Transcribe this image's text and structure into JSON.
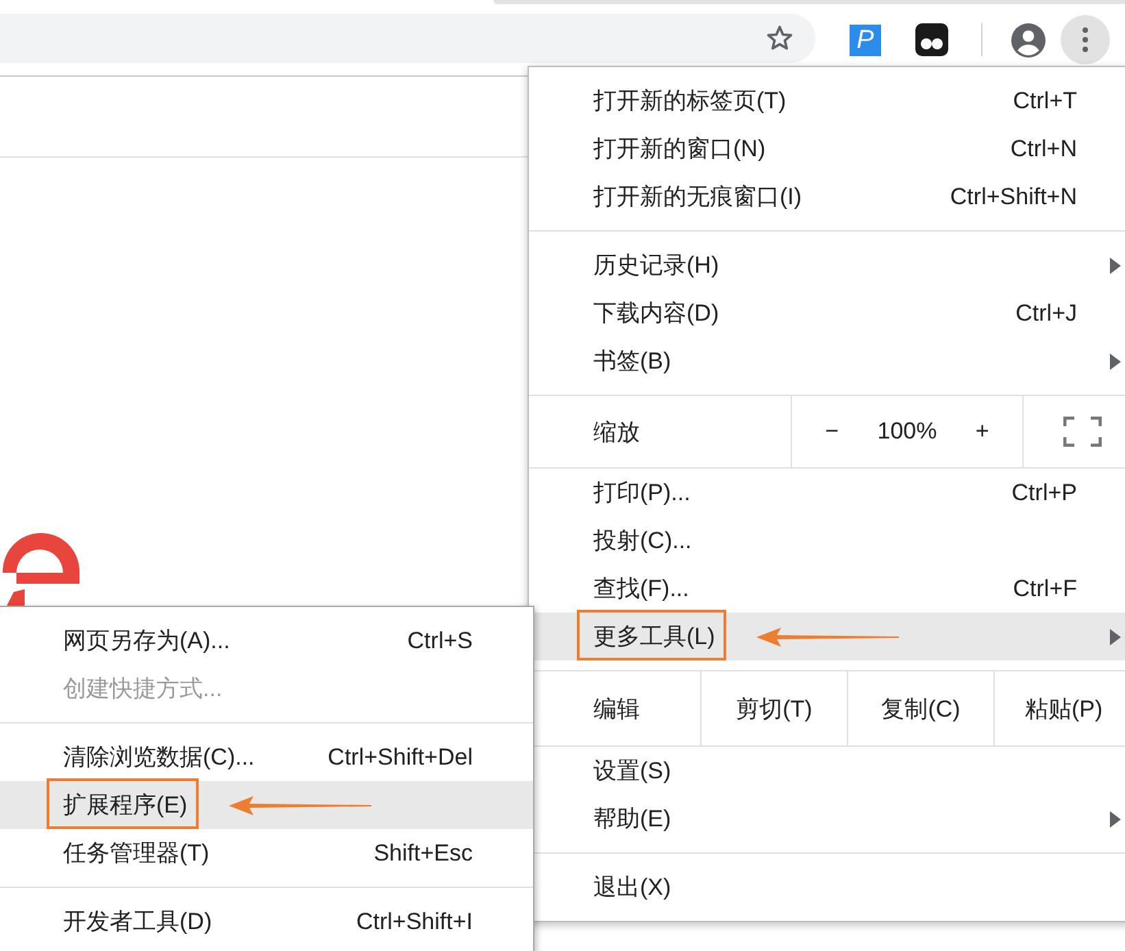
{
  "toolbar": {
    "extensions": [
      {
        "kind": "letter",
        "label": "P"
      },
      {
        "kind": "eyes"
      }
    ]
  },
  "main_menu": {
    "items": [
      {
        "kind": "item",
        "label": "打开新的标签页(T)",
        "shortcut": "Ctrl+T",
        "has_submenu": false,
        "highlighted": false,
        "annotated": false
      },
      {
        "kind": "item",
        "label": "打开新的窗口(N)",
        "shortcut": "Ctrl+N",
        "has_submenu": false,
        "highlighted": false,
        "annotated": false
      },
      {
        "kind": "item",
        "label": "打开新的无痕窗口(I)",
        "shortcut": "Ctrl+Shift+N",
        "has_submenu": false,
        "highlighted": false,
        "annotated": false
      },
      {
        "kind": "separator"
      },
      {
        "kind": "item",
        "label": "历史记录(H)",
        "has_submenu": true,
        "highlighted": false,
        "annotated": false
      },
      {
        "kind": "item",
        "label": "下载内容(D)",
        "shortcut": "Ctrl+J",
        "has_submenu": false,
        "highlighted": false,
        "annotated": false
      },
      {
        "kind": "item",
        "label": "书签(B)",
        "has_submenu": true,
        "highlighted": false,
        "annotated": false
      },
      {
        "kind": "separator"
      },
      {
        "kind": "zoom",
        "label": "缩放",
        "minus": "−",
        "value": "100%",
        "plus": "+"
      },
      {
        "kind": "separator"
      },
      {
        "kind": "item",
        "label": "打印(P)...",
        "shortcut": "Ctrl+P",
        "has_submenu": false,
        "highlighted": false,
        "annotated": false
      },
      {
        "kind": "item",
        "label": "投射(C)...",
        "has_submenu": false,
        "highlighted": false,
        "annotated": false
      },
      {
        "kind": "item",
        "label": "查找(F)...",
        "shortcut": "Ctrl+F",
        "has_submenu": false,
        "highlighted": false,
        "annotated": false
      },
      {
        "kind": "item",
        "label": "更多工具(L)",
        "has_submenu": true,
        "highlighted": true,
        "annotated": true
      },
      {
        "kind": "separator"
      },
      {
        "kind": "edit",
        "label": "编辑",
        "buttons": [
          "剪切(T)",
          "复制(C)",
          "粘贴(P)"
        ]
      },
      {
        "kind": "separator"
      },
      {
        "kind": "item",
        "label": "设置(S)",
        "has_submenu": false,
        "highlighted": false,
        "annotated": false
      },
      {
        "kind": "item",
        "label": "帮助(E)",
        "has_submenu": true,
        "highlighted": false,
        "annotated": false
      },
      {
        "kind": "separator"
      },
      {
        "kind": "item",
        "label": "退出(X)",
        "has_submenu": false,
        "highlighted": false,
        "annotated": false
      }
    ]
  },
  "submenu": {
    "items": [
      {
        "kind": "item",
        "label": "网页另存为(A)...",
        "shortcut": "Ctrl+S",
        "disabled": false,
        "highlighted": false,
        "annotated": false
      },
      {
        "kind": "item",
        "label": "创建快捷方式...",
        "disabled": true,
        "highlighted": false,
        "annotated": false
      },
      {
        "kind": "separator"
      },
      {
        "kind": "item",
        "label": "清除浏览数据(C)...",
        "shortcut": "Ctrl+Shift+Del",
        "disabled": false,
        "highlighted": false,
        "annotated": false
      },
      {
        "kind": "item",
        "label": "扩展程序(E)",
        "disabled": false,
        "highlighted": true,
        "annotated": true
      },
      {
        "kind": "item",
        "label": "任务管理器(T)",
        "shortcut": "Shift+Esc",
        "disabled": false,
        "highlighted": false,
        "annotated": false
      },
      {
        "kind": "separator"
      },
      {
        "kind": "item",
        "label": "开发者工具(D)",
        "shortcut": "Ctrl+Shift+I",
        "disabled": false,
        "highlighted": false,
        "annotated": false
      }
    ]
  }
}
